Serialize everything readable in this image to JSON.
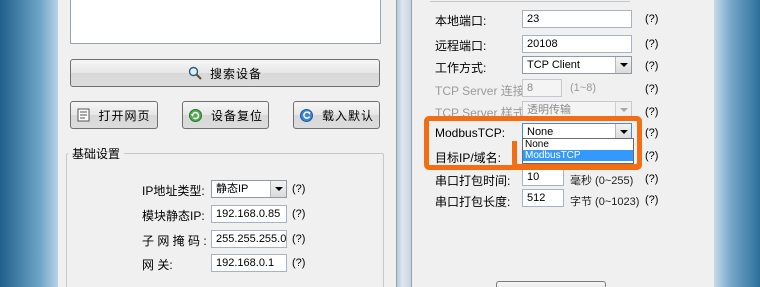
{
  "buttons": {
    "search": "搜索设备",
    "open_web": "打开网页",
    "reset": "设备复位",
    "load_default": "载入默认"
  },
  "left_section": {
    "title": "基础设置",
    "ip_type_label": "IP地址类型:",
    "ip_type_value": "静态IP",
    "static_ip_label": "模块静态IP:",
    "static_ip_value": "192.168.0.85",
    "mask_label": "子 网 掩 码 :",
    "mask_value": "255.255.255.0",
    "gateway_label": "网      关:",
    "gateway_value": "192.168.0.1"
  },
  "right_section": {
    "local_port_label": "本地端口:",
    "local_port_value": "23",
    "remote_port_label": "远程端口:",
    "remote_port_value": "20108",
    "work_mode_label": "工作方式:",
    "work_mode_value": "TCP Client",
    "conn_count_label": "TCP Server 连接数:",
    "conn_count_value": "8",
    "conn_count_hint": "(1~8)",
    "server_style_label": "TCP Server 样式:",
    "server_style_value": "透明传输",
    "modbus_label": "ModbusTCP:",
    "modbus_value": "None",
    "modbus_options": [
      "None",
      "ModbusTCP"
    ],
    "target_label": "目标IP/域名:",
    "pack_time_label": "串口打包时间:",
    "pack_time_value": "10",
    "pack_time_hint": "毫秒 (0~255)",
    "pack_len_label": "串口打包长度:",
    "pack_len_value": "512",
    "pack_len_hint": "字节 (0~1023)"
  },
  "help_mark": "(?)",
  "colors": {
    "highlight": "#f26d13",
    "selection": "#3399ff"
  },
  "icons": [
    "search-icon",
    "open-web-icon",
    "reset-icon",
    "load-default-icon",
    "dropdown-arrow-icon"
  ]
}
